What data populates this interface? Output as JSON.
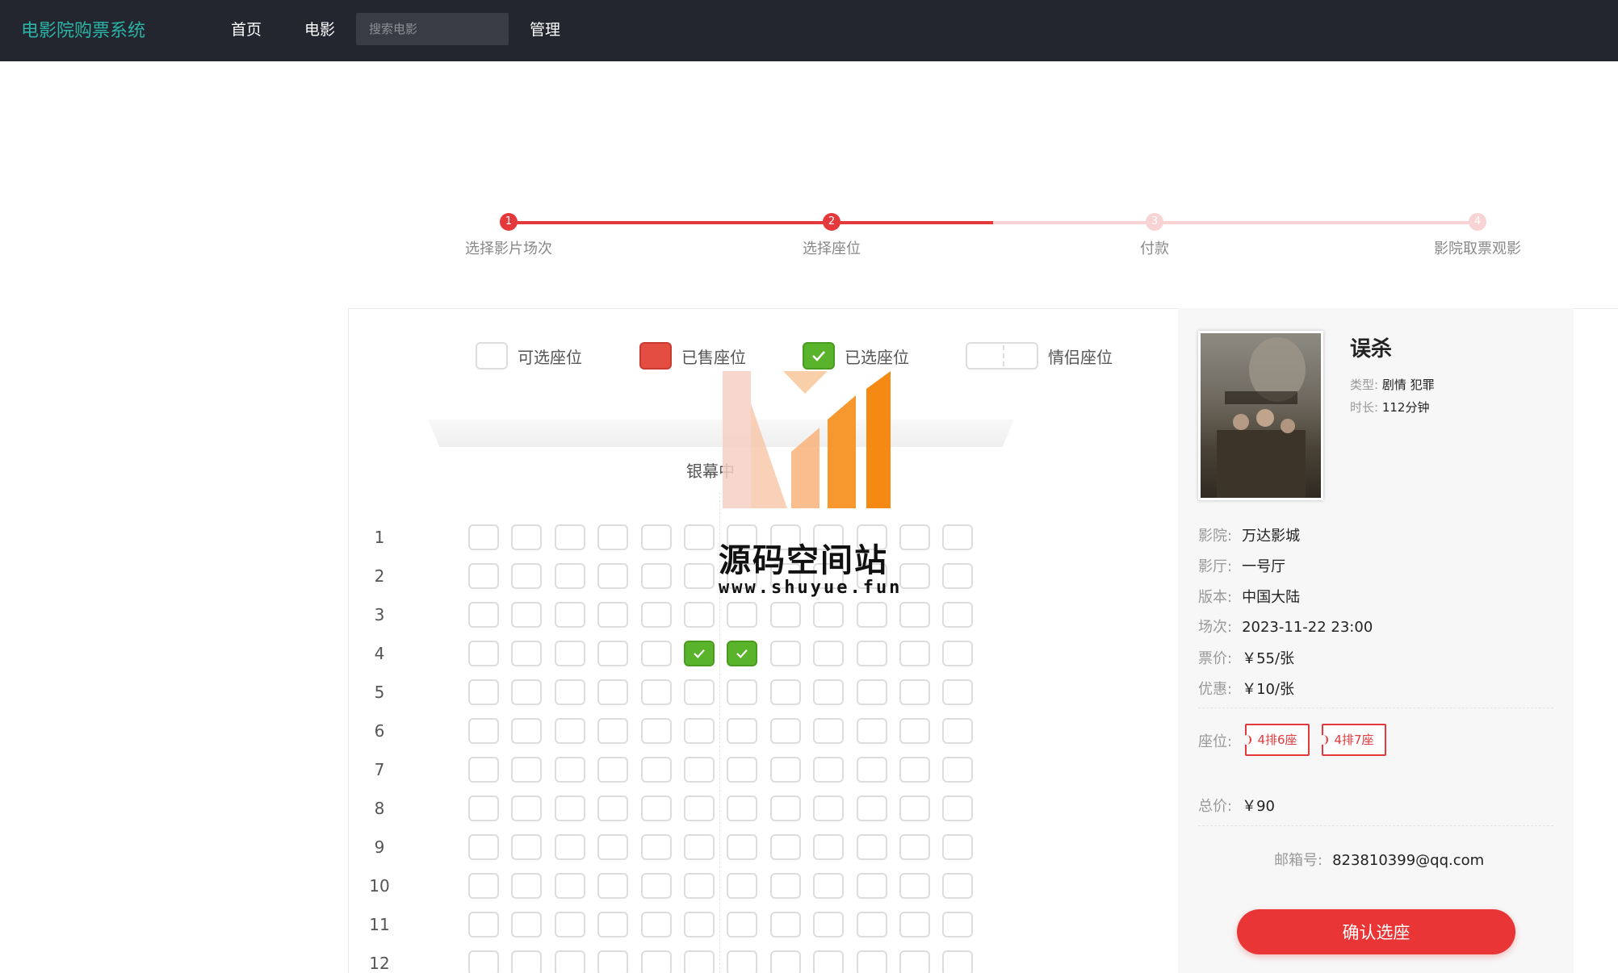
{
  "header": {
    "brand": "电影院购票系统",
    "nav": [
      "首页",
      "电影",
      "管理"
    ],
    "search_placeholder": "搜索电影"
  },
  "steps": [
    {
      "num": "1",
      "label": "选择影片场次",
      "active": true
    },
    {
      "num": "2",
      "label": "选择座位",
      "active": true
    },
    {
      "num": "3",
      "label": "付款",
      "active": false
    },
    {
      "num": "4",
      "label": "影院取票观影",
      "active": false
    }
  ],
  "legend": {
    "available": "可选座位",
    "sold": "已售座位",
    "selected": "已选座位",
    "couple": "情侣座位"
  },
  "screen_label": "银幕中",
  "seatmap": {
    "rows": [
      "1",
      "2",
      "3",
      "4",
      "5",
      "6",
      "7",
      "8",
      "9",
      "10",
      "11",
      "12"
    ],
    "cols": 12,
    "selected": [
      [
        4,
        6
      ],
      [
        4,
        7
      ]
    ],
    "sold": []
  },
  "watermark": {
    "title": "源码空间站",
    "url": "www.shuyue.fun"
  },
  "movie": {
    "title": "误杀",
    "genre_label": "类型:",
    "genre": "剧情 犯罪",
    "duration_label": "时长:",
    "duration": "112分钟"
  },
  "info": {
    "cinema_label": "影院:",
    "cinema": "万达影城",
    "hall_label": "影厅:",
    "hall": "一号厅",
    "version_label": "版本:",
    "version": "中国大陆",
    "session_label": "场次:",
    "session": "2023-11-22 23:00",
    "price_label": "票价:",
    "price": "￥55/张",
    "discount_label": "优惠:",
    "discount": "￥10/张",
    "seats_label": "座位:",
    "seats": [
      "4排6座",
      "4排7座"
    ],
    "total_label": "总价:",
    "total": "￥90",
    "email_label": "邮箱号:",
    "email": "823810399@qq.com"
  },
  "confirm_label": "确认选座",
  "colors": {
    "accent": "#e93535",
    "selected": "#5ab42b",
    "sold": "#e44d42",
    "brand": "#2ab3a6",
    "topbar": "#23262e"
  }
}
